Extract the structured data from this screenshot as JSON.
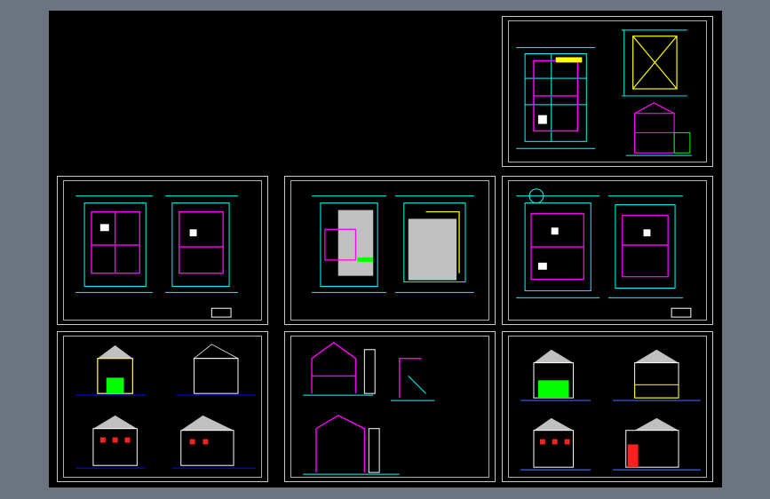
{
  "colors": {
    "background": "#000000",
    "frame": "#6c7480",
    "sheet_border": "#c8c8c8",
    "cyan": "#00ffff",
    "magenta": "#ff00ff",
    "yellow": "#ffff00",
    "white": "#ffffff",
    "green": "#00ff00",
    "red": "#ff2020",
    "blue": "#4060ff",
    "gray_fill": "#c0c0c0"
  },
  "sheets": [
    {
      "id": "sheet-roof-plans",
      "type": "plan-group"
    },
    {
      "id": "sheet-floor-plans-1",
      "type": "plan-pair"
    },
    {
      "id": "sheet-floor-plans-2",
      "type": "plan-pair-roof"
    },
    {
      "id": "sheet-floor-plans-3",
      "type": "plan-pair"
    },
    {
      "id": "sheet-elevations-1",
      "type": "elevations"
    },
    {
      "id": "sheet-sections",
      "type": "sections"
    },
    {
      "id": "sheet-elevations-2",
      "type": "elevations"
    }
  ]
}
